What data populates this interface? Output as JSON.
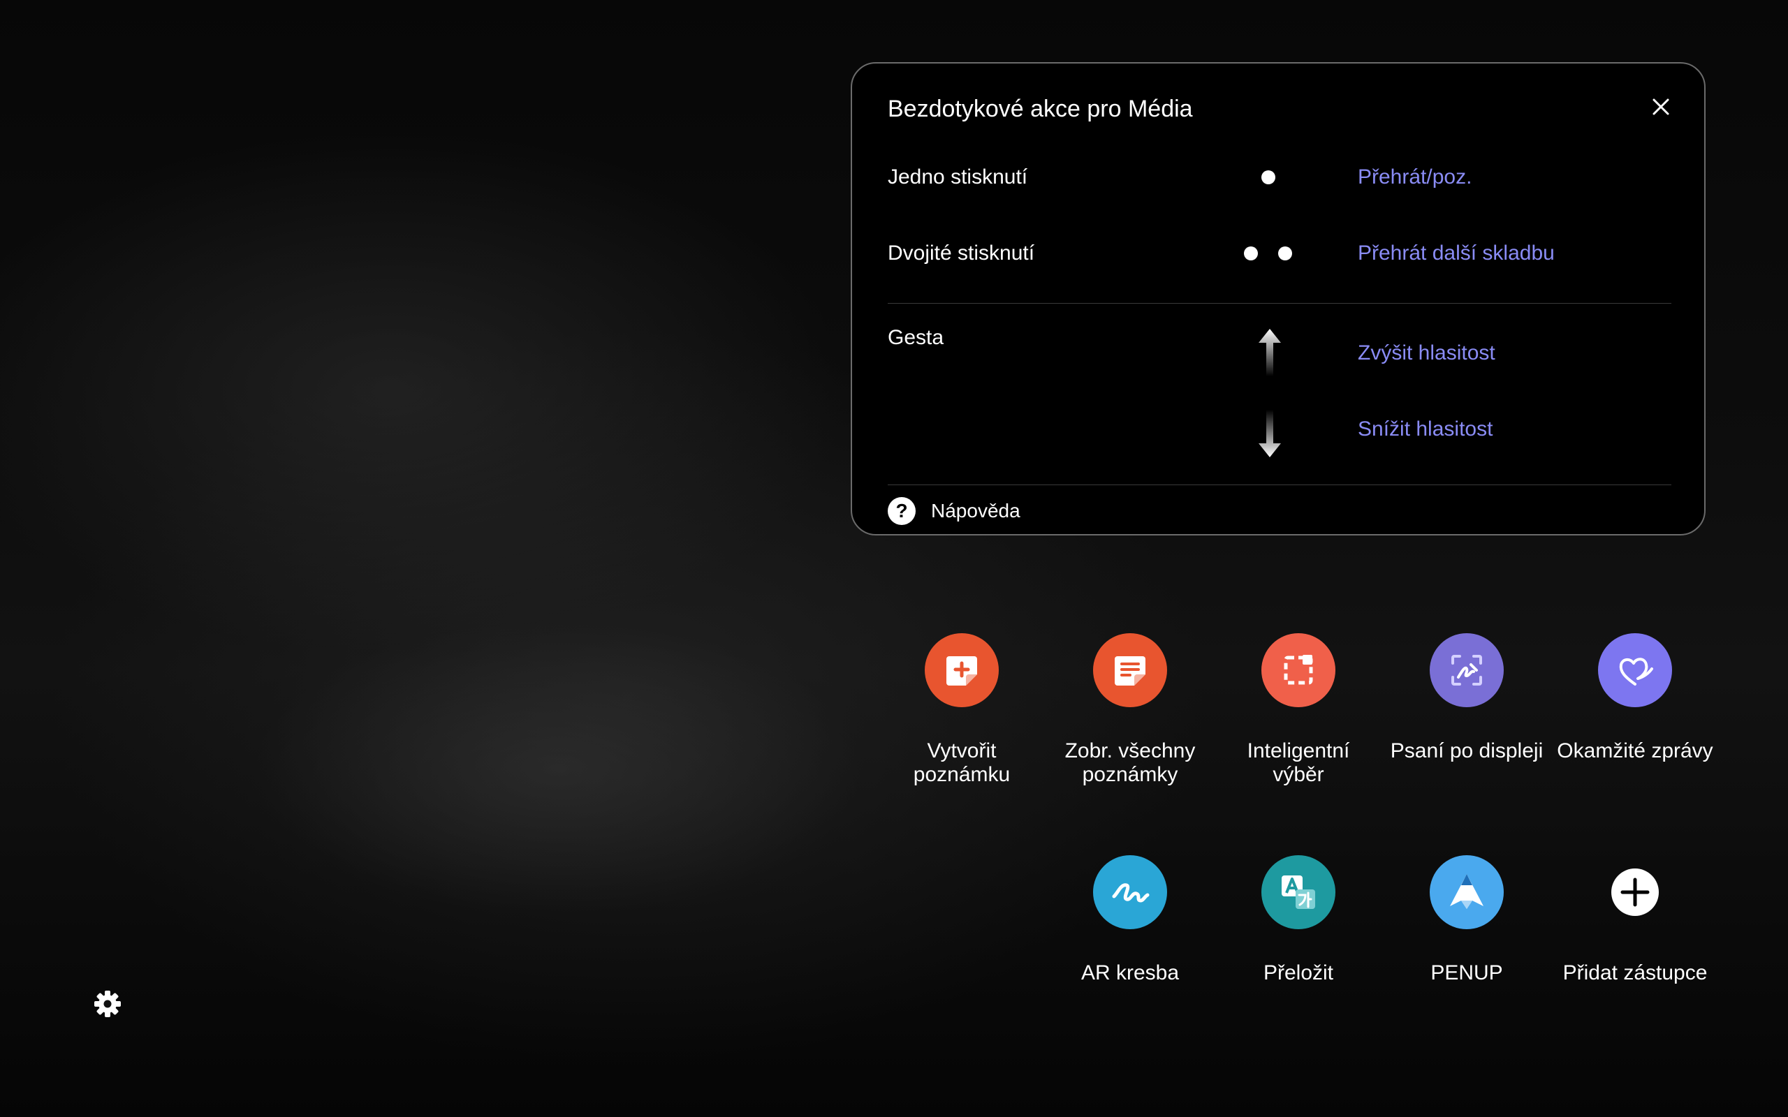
{
  "panel": {
    "title": "Bezdotykové akce pro Média",
    "rows": [
      {
        "label": "Jedno stisknutí",
        "action": "Přehrát/poz."
      },
      {
        "label": "Dvojité stisknutí",
        "action": "Přehrát další skladbu"
      }
    ],
    "gestures": {
      "label": "Gesta",
      "up_action": "Zvýšit hlasitost",
      "down_action": "Snížit hlasitost"
    },
    "help_label": "Nápověda"
  },
  "shortcuts": [
    {
      "label": "Vytvořit\npoznámku",
      "icon": "create-note-icon",
      "color": "#e8552f"
    },
    {
      "label": "Zobr. všechny\npoznámky",
      "icon": "view-notes-icon",
      "color": "#e8552f"
    },
    {
      "label": "Inteligentní\nvýběr",
      "icon": "smart-select-icon",
      "color": "#f0604a"
    },
    {
      "label": "Psaní po displeji",
      "icon": "screen-write-icon",
      "color": "#7a6fd6"
    },
    {
      "label": "Okamžité zprávy",
      "icon": "live-messages-icon",
      "color": "#7d76f0"
    },
    {
      "label": "AR kresba",
      "icon": "ar-doodle-icon",
      "color": "#2aa6d6"
    },
    {
      "label": "Přeložit",
      "icon": "translate-icon",
      "color": "#1e9aa0"
    },
    {
      "label": "PENUP",
      "icon": "penup-icon",
      "color": "#4aa9ee"
    },
    {
      "label": "Přidat zástupce",
      "icon": "add-shortcut-icon",
      "color": "#ffffff"
    }
  ]
}
